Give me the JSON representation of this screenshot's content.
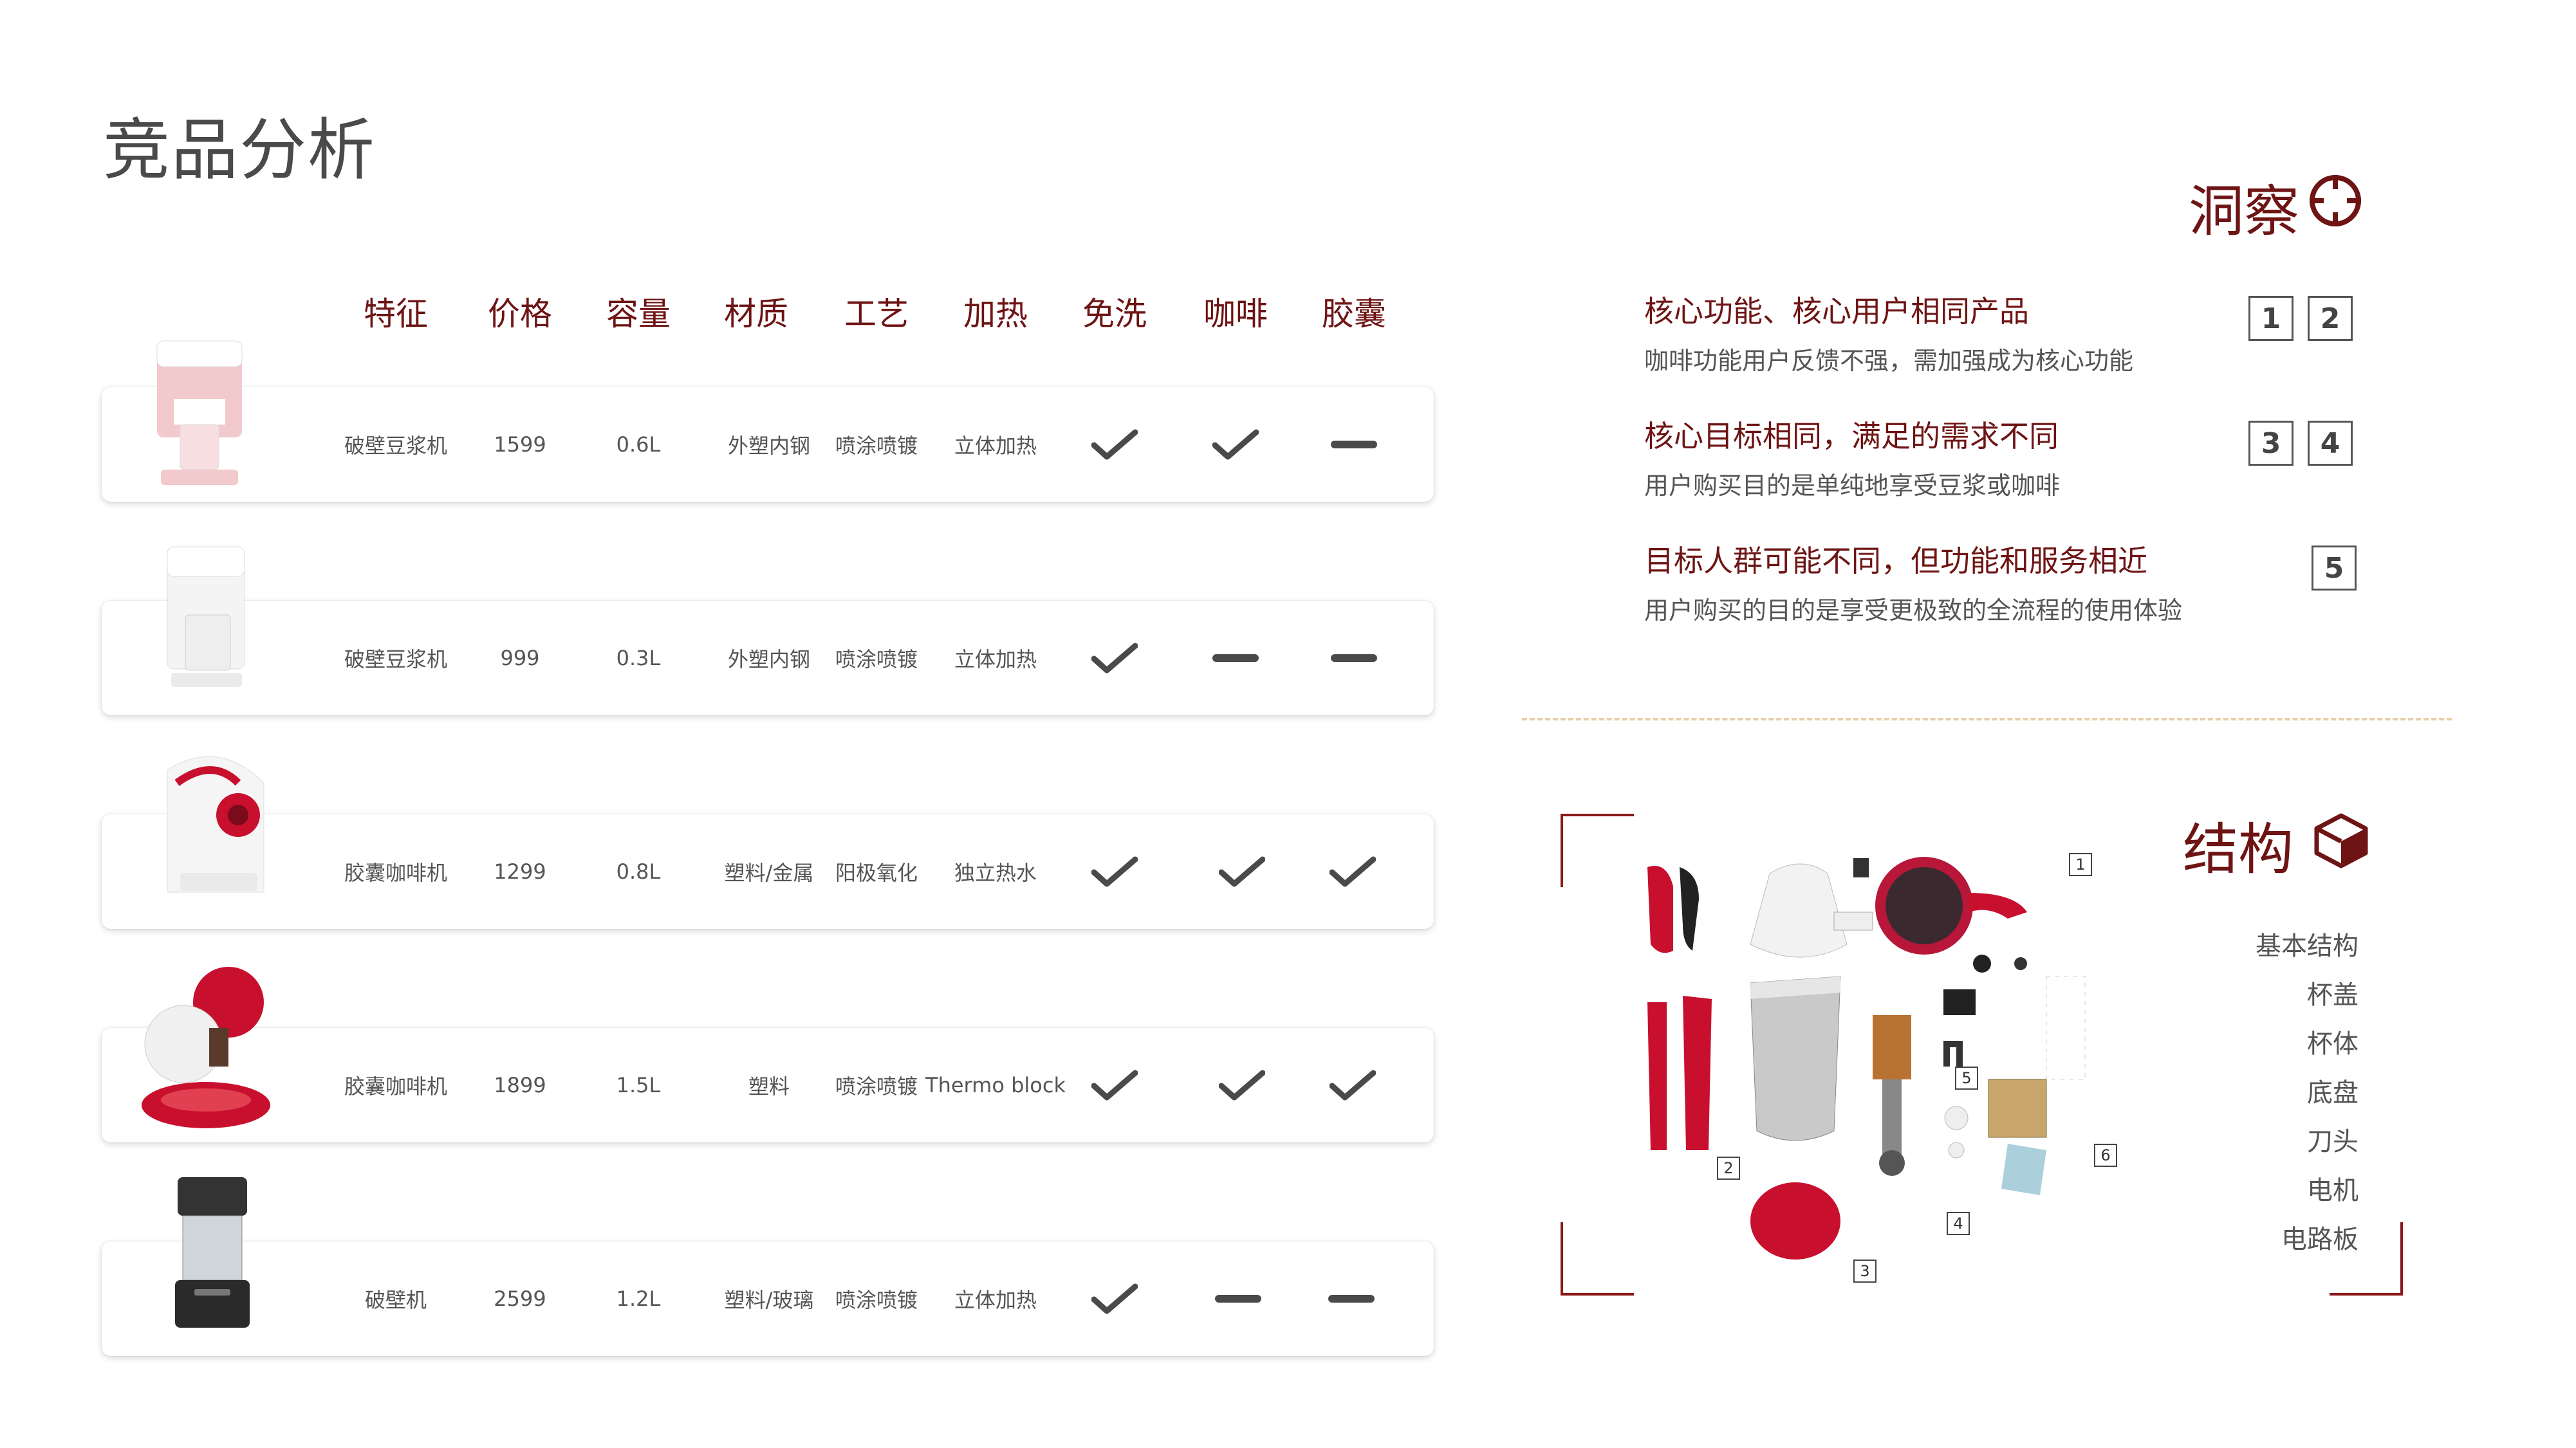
{
  "page_title": "竞品分析",
  "table": {
    "headers": [
      "特征",
      "价格",
      "容量",
      "材质",
      "工艺",
      "加热",
      "免洗",
      "咖啡",
      "胶囊"
    ],
    "rows": [
      {
        "feature": "破壁豆浆机",
        "price": "1599",
        "capacity": "0.6L",
        "material": "外塑内钢",
        "process": "喷涂喷镀",
        "heating": "立体加热",
        "no_wash": "check",
        "coffee": "check",
        "capsule": "dash",
        "image": "pink-soymilk-maker"
      },
      {
        "feature": "破壁豆浆机",
        "price": "999",
        "capacity": "0.3L",
        "material": "外塑内钢",
        "process": "喷涂喷镀",
        "heating": "立体加热",
        "no_wash": "check",
        "coffee": "dash",
        "capsule": "dash",
        "image": "white-soymilk-maker"
      },
      {
        "feature": "胶囊咖啡机",
        "price": "1299",
        "capacity": "0.8L",
        "material": "塑料/金属",
        "process": "阳极氧化",
        "heating": "独立热水",
        "no_wash": "check",
        "coffee": "check",
        "capsule": "check",
        "image": "white-red-capsule-coffee-machine"
      },
      {
        "feature": "胶囊咖啡机",
        "price": "1899",
        "capacity": "1.5L",
        "material": "塑料",
        "process": "喷涂喷镀",
        "heating": "Thermo block",
        "no_wash": "check",
        "coffee": "check",
        "capsule": "check",
        "image": "red-round-capsule-coffee-machine"
      },
      {
        "feature": "破壁机",
        "price": "2599",
        "capacity": "1.2L",
        "material": "塑料/玻璃",
        "process": "喷涂喷镀",
        "heating": "立体加热",
        "no_wash": "check",
        "coffee": "dash",
        "capsule": "dash",
        "image": "black-blender"
      }
    ]
  },
  "insight": {
    "heading": "洞察",
    "icon": "target-crosshair-icon",
    "items": [
      {
        "title": "核心功能、核心用户相同产品",
        "desc": "咖啡功能用户反馈不强，需加强成为核心功能",
        "refs": [
          "1",
          "2"
        ]
      },
      {
        "title": "核心目标相同，满足的需求不同",
        "desc": "用户购买目的是单纯地享受豆浆或咖啡",
        "refs": [
          "3",
          "4"
        ]
      },
      {
        "title": "目标人群可能不同，但功能和服务相近",
        "desc": "用户购买的目的是享受更极致的全流程的使用体验",
        "refs": [
          "5"
        ]
      }
    ]
  },
  "structure": {
    "heading": "结构",
    "icon": "cube-icon",
    "items": [
      "基本结构",
      "杯盖",
      "杯体",
      "底盘",
      "刀头",
      "电机",
      "电路板"
    ],
    "part_labels": [
      "1",
      "2",
      "3",
      "4",
      "5",
      "6"
    ]
  },
  "colors": {
    "accent": "#6e1414",
    "text": "#555555",
    "check": "#4a4a4a",
    "divider": "#e8cfa8",
    "product_red": "#c8102e"
  }
}
